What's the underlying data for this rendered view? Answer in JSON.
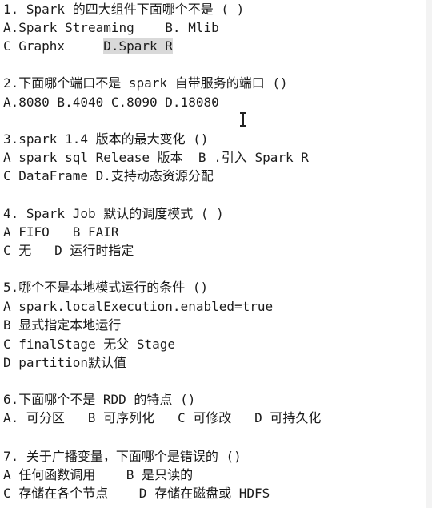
{
  "lines": [
    {
      "text": "1. Spark 的四大组件下面哪个不是 ( )"
    },
    {
      "text": "A.Spark Streaming    B. Mlib"
    },
    {
      "text_before": "C Graphx     ",
      "highlight": "D.Spark R"
    },
    {
      "text": "2.下面哪个端口不是 spark 自带服务的端口 ()"
    },
    {
      "text": "A.8080 B.4040 C.8090 D.18080"
    },
    {
      "text": "3.spark 1.4 版本的最大变化 ()"
    },
    {
      "text": "A spark sql Release 版本  B .引入 Spark R"
    },
    {
      "text": "C DataFrame D.支持动态资源分配"
    },
    {
      "text": "4. Spark Job 默认的调度模式 ( )"
    },
    {
      "text": "A FIFO   B FAIR"
    },
    {
      "text": "C 无   D 运行时指定"
    },
    {
      "text": "5.哪个不是本地模式运行的条件 ()"
    },
    {
      "text": "A spark.localExecution.enabled=true"
    },
    {
      "text": "B 显式指定本地运行"
    },
    {
      "text": "C finalStage 无父 Stage"
    },
    {
      "text": "D partition默认值"
    },
    {
      "text": "6.下面哪个不是 RDD 的特点 ()"
    },
    {
      "text": "A. 可分区   B 可序列化   C 可修改   D 可持久化"
    },
    {
      "text": "7. 关于广播变量，下面哪个是错误的 ()"
    },
    {
      "text": "A 任何函数调用    B 是只读的"
    },
    {
      "text": "C 存储在各个节点    D 存储在磁盘或 HDFS"
    }
  ]
}
